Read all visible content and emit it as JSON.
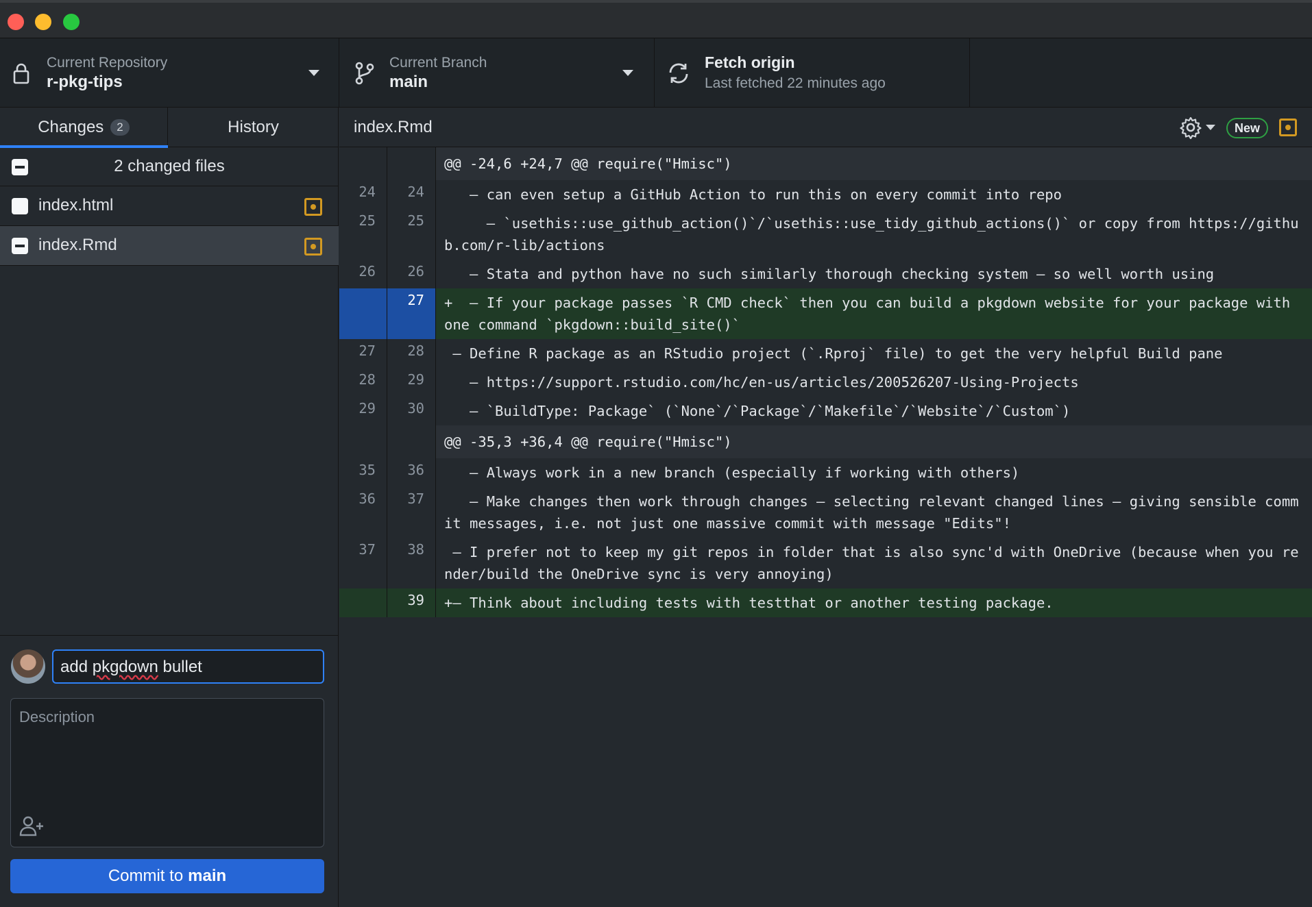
{
  "repo": {
    "label": "Current Repository",
    "name": "r-pkg-tips"
  },
  "branch": {
    "label": "Current Branch",
    "name": "main"
  },
  "fetch": {
    "title": "Fetch origin",
    "subtitle": "Last fetched 22 minutes ago"
  },
  "tabs": {
    "changes": "Changes",
    "changes_count": "2",
    "history": "History"
  },
  "files": {
    "header": "2 changed files",
    "items": [
      {
        "name": "index.html"
      },
      {
        "name": "index.Rmd"
      }
    ]
  },
  "commit": {
    "summary_value": "add pkgdown bullet",
    "summary_plain": "add ",
    "summary_misspelled": "pkgdown",
    "summary_rest": " bullet",
    "description_placeholder": "Description",
    "button_prefix": "Commit to",
    "button_branch": "main"
  },
  "diff": {
    "filename": "index.Rmd",
    "new_badge": "New",
    "lines": [
      {
        "type": "hunk",
        "old": "",
        "new": "",
        "text": "@@ -24,6 +24,7 @@ require(\"Hmisc\")"
      },
      {
        "type": "ctx",
        "old": "24",
        "new": "24",
        "text": "   – can even setup a GitHub Action to run this on every commit into repo"
      },
      {
        "type": "ctx",
        "old": "25",
        "new": "25",
        "text": "     – `usethis::use_github_action()`/`usethis::use_tidy_github_actions()` or copy from https://github.com/r-lib/actions"
      },
      {
        "type": "ctx",
        "old": "26",
        "new": "26",
        "text": "   – Stata and python have no such similarly thorough checking system – so well worth using"
      },
      {
        "type": "add",
        "old": "",
        "new": "27",
        "text": "+  – If your package passes `R CMD check` then you can build a pkgdown website for your package with one command `pkgdown::build_site()`"
      },
      {
        "type": "ctx",
        "old": "27",
        "new": "28",
        "text": " – Define R package as an RStudio project (`.Rproj` file) to get the very helpful Build pane"
      },
      {
        "type": "ctx",
        "old": "28",
        "new": "29",
        "text": "   – https://support.rstudio.com/hc/en-us/articles/200526207-Using-Projects"
      },
      {
        "type": "ctx",
        "old": "29",
        "new": "30",
        "text": "   – `BuildType: Package` (`None`/`Package`/`Makefile`/`Website`/`Custom`)"
      },
      {
        "type": "hunk",
        "old": "",
        "new": "",
        "text": "@@ -35,3 +36,4 @@ require(\"Hmisc\")"
      },
      {
        "type": "ctx",
        "old": "35",
        "new": "36",
        "text": "   – Always work in a new branch (especially if working with others)"
      },
      {
        "type": "ctx",
        "old": "36",
        "new": "37",
        "text": "   – Make changes then work through changes – selecting relevant changed lines – giving sensible commit messages, i.e. not just one massive commit with message \"Edits\"!"
      },
      {
        "type": "ctx",
        "old": "37",
        "new": "38",
        "text": " – I prefer not to keep my git repos in folder that is also sync'd with OneDrive (because when you render/build the OneDrive sync is very annoying)"
      },
      {
        "type": "add",
        "old": "",
        "new": "39",
        "text": "+– Think about including tests with testthat or another testing package."
      }
    ]
  },
  "icons": {
    "repo": "lock-icon",
    "branch": "git-branch-icon",
    "fetch": "sync-icon",
    "settings": "gear-icon",
    "coauthor": "person-add-icon",
    "modified": "file-modified-icon"
  },
  "colors": {
    "accent": "#2f81f7",
    "added_bg": "#1f3a26",
    "selected_gutter": "#1c4fa3",
    "modified": "#d29922",
    "commit_button": "#2666d6"
  }
}
